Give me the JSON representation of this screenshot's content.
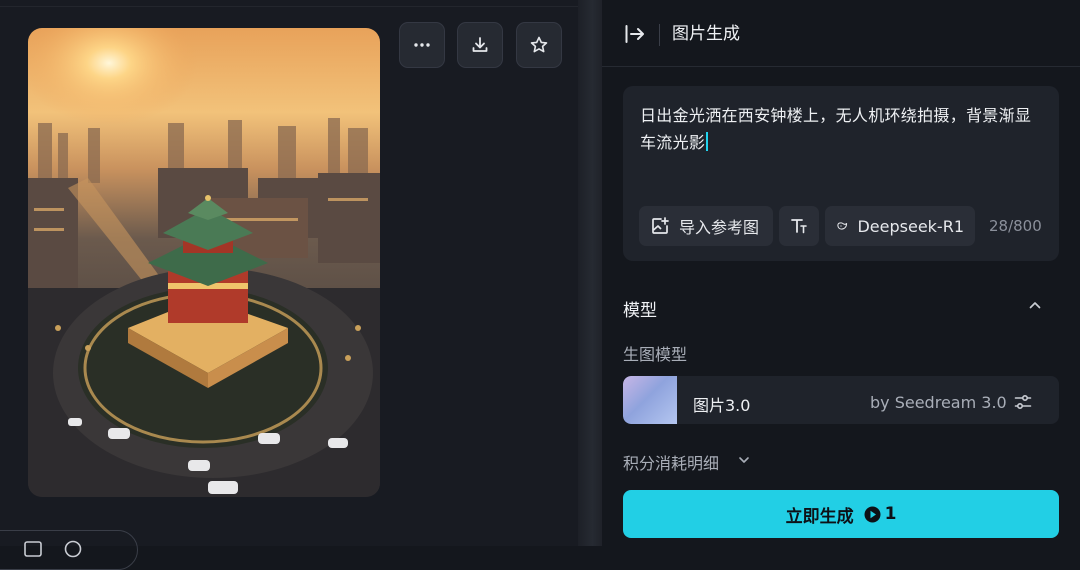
{
  "canvas": {
    "image_alt": "Drum/Bell tower at sunrise, aerial view with traffic circle",
    "toolbar": {
      "more_icon": "more-horizontal-icon",
      "download_icon": "download-icon",
      "favorite_icon": "star-icon"
    }
  },
  "panel": {
    "title": "图片生成",
    "collapse_icon": "collapse-right-icon",
    "prompt": {
      "text": "日出金光洒在西安钟楼上，无人机环绕拍摄，背景渐显车流光影",
      "counter": "28/800"
    },
    "chips": {
      "import_ref": "导入参考图",
      "text_style_icon": "text-style-icon",
      "deepseek": "Deepseek-R1"
    },
    "model_section": {
      "title": "模型",
      "subtitle": "生图模型",
      "model_name": "图片3.0",
      "model_by": "by Seedream 3.0"
    },
    "points_detail": "积分消耗明细",
    "generate": {
      "label": "立即生成",
      "cost": "1"
    }
  },
  "colors": {
    "accent": "#22cfe5",
    "panel_bg": "#14171d",
    "card_bg": "#1f232b"
  }
}
